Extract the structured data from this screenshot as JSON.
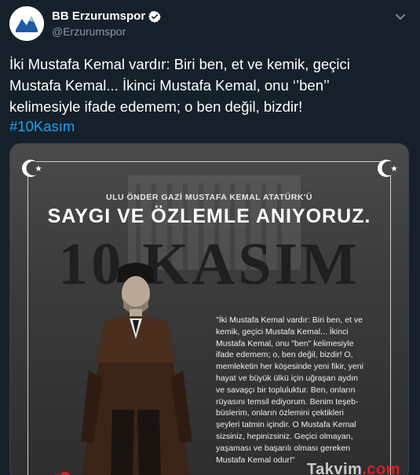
{
  "account": {
    "name": "BB Erzurumspor",
    "handle": "@Erzurumspor"
  },
  "tweet": {
    "lines": [
      "İki Mustafa Kemal vardır: Biri ben, et ve kemik, geçici",
      "Mustafa Kemal... İkinci Mustafa Kemal, onu ‘’ben’’",
      "kelimesiyle ifade edemem; o ben değil, bizdir!"
    ],
    "hashtag": "#10Kasım"
  },
  "poster": {
    "subtitle": "ULU ÖNDER GAZİ MUSTAFA KEMAL ATATÜRK'Ü",
    "title": "SAYGI VE ÖZLEMLE ANIYORUZ.",
    "date": "10 KASIM",
    "quote_lines": [
      "\"İki Mustafa Kemal vardır: Biri ben, et ve",
      "kemik, geçici Mustafa Kemal... İkinci",
      "Mustafa Kemal, onu \"ben\" kelimesiyle",
      "ifade edemem; o, ben değil, bizdir! O,",
      "memleketin her köşesinde yeni fikir, yeni",
      "hayat ve büyük ülkü için uğraşan aydın",
      "ve savaşçı bir topluluktur. Ben, onların",
      "rüyasını temsil ediyorum. Benim teşeb-",
      "büslerim, onların özlemini çektikleri",
      "şeyleri tatmin içindir. O Mustafa Kemal",
      "sizsiniz, hepinizsiniz. Geçici olmayan,",
      "yaşaması ve başarılı olması gereken",
      "Mustafa Kemal odur!\""
    ]
  },
  "watermark": {
    "text": "Takvim",
    "suffix": ".com"
  },
  "colors": {
    "background": "#15202b",
    "link": "#1da1f2",
    "muted": "#8899a6",
    "verified": "#1da1f2"
  },
  "icons": {
    "verified": "verified-badge-icon",
    "more": "chevron-down-icon"
  }
}
